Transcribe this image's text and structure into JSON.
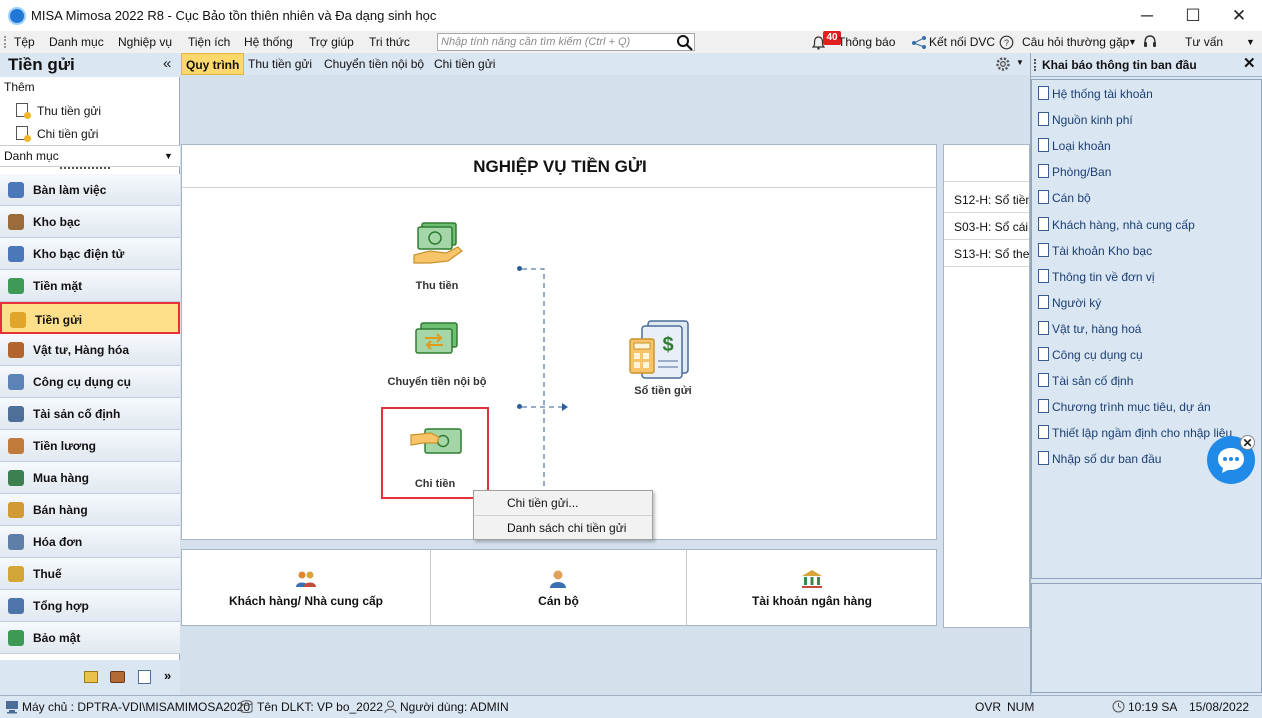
{
  "window": {
    "title": "MISA Mimosa 2022 R8 - Cục Bảo tồn thiên nhiên và Đa dạng sinh học",
    "minimize": "─",
    "maximize": "☐",
    "close": "✕"
  },
  "menu": {
    "items": [
      "Tệp",
      "Danh mục",
      "Nghiệp vụ",
      "Tiện ích",
      "Hệ thống",
      "Trợ giúp",
      "Tri thức"
    ],
    "search_placeholder": "Nhập tính năng cần tìm kiếm (Ctrl + Q)",
    "notification_count": "40",
    "notification_label": "Thông báo",
    "connect_label": "Kết nối DVC",
    "faq_label": "Câu hỏi thường gặp",
    "support_label": "Tư vấn"
  },
  "left_panel": {
    "title": "Tiền gửi",
    "collapse": "«",
    "add_header": "Thêm",
    "add_items": [
      "Thu tiền gửi",
      "Chi tiền gửi"
    ],
    "category_label": "Danh mục",
    "nav_items": [
      {
        "label": "Bàn làm việc",
        "color": "#4b78b8"
      },
      {
        "label": "Kho bạc",
        "color": "#9a6c3c"
      },
      {
        "label": "Kho bạc điện tử",
        "color": "#4b78b8"
      },
      {
        "label": "Tiền mặt",
        "color": "#3e9b57"
      },
      {
        "label": "Tiền gửi",
        "color": "#e1a52a"
      },
      {
        "label": "Vật tư, Hàng hóa",
        "color": "#b3642e"
      },
      {
        "label": "Công cụ dụng cụ",
        "color": "#5b83b5"
      },
      {
        "label": "Tài sản cố định",
        "color": "#4f6f99"
      },
      {
        "label": "Tiền lương",
        "color": "#c07a3a"
      },
      {
        "label": "Mua hàng",
        "color": "#3b7f4f"
      },
      {
        "label": "Bán hàng",
        "color": "#d19a32"
      },
      {
        "label": "Hóa đơn",
        "color": "#5f7ea8"
      },
      {
        "label": "Thuế",
        "color": "#d2a534"
      },
      {
        "label": "Tổng hợp",
        "color": "#4d75aa"
      },
      {
        "label": "Bảo mật",
        "color": "#3d9a55"
      }
    ],
    "active_index": 4,
    "more": "»"
  },
  "tabs": [
    "Quy trình",
    "Thu tiền gửi",
    "Chuyển tiền nội bộ",
    "Chi tiền gửi"
  ],
  "active_tab": 0,
  "workflow": {
    "title": "NGHIỆP VỤ TIỀN GỬI",
    "nodes": {
      "receive": "Thu tiền",
      "transfer": "Chuyển tiền nội bộ",
      "pay": "Chi tiền",
      "book": "Sổ tiền gửi"
    }
  },
  "context_menu": {
    "items": [
      "Chi tiền gửi...",
      "Danh sách chi tiền gửi"
    ]
  },
  "shortcuts": [
    "Khách hàng/ Nhà cung cấp",
    "Cán bộ",
    "Tài khoản ngân hàng"
  ],
  "reports": [
    "S12-H: Sổ tiền g",
    "S03-H: Sổ cái -",
    "S13-H: Sổ theo"
  ],
  "right_panel": {
    "title": "Khai báo thông tin ban đầu",
    "close": "✕",
    "items": [
      "Hệ thống tài khoản",
      "Nguồn kinh phí",
      "Loại khoản",
      "Phòng/Ban",
      "Cán bộ",
      "Khách hàng, nhà cung cấp",
      "Tài khoản Kho bạc",
      "Thông tin về đơn vị",
      "Người ký",
      "Vật tư, hàng hoá",
      "Công cụ dụng cụ",
      "Tài sản cố định",
      "Chương trình mục tiêu, dự án",
      "Thiết lập ngầm định cho nhập liệu",
      "Nhập số dư ban đầu"
    ]
  },
  "chat": {
    "close": "✕"
  },
  "status": {
    "server": "Máy chủ : DPTRA-VDI\\MISAMIMOSA2020",
    "db": "Tên DLKT: VP bo_2022",
    "user": "Người dùng: ADMIN",
    "ovr": "OVR",
    "num": "NUM",
    "time": "10:19 SA",
    "date": "15/08/2022"
  }
}
